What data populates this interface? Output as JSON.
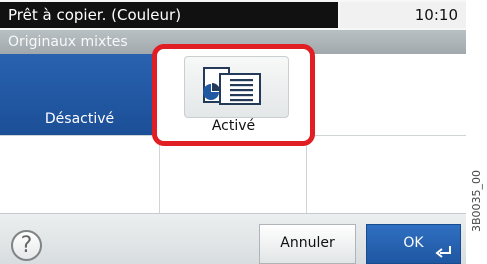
{
  "status": {
    "message": "Prêt à copier. (Couleur)",
    "time": "10:10"
  },
  "screen": {
    "title": "Originaux mixtes"
  },
  "options": {
    "off_label": "Désactivé",
    "on_label": "Activé",
    "selected": "Désactivé"
  },
  "buttons": {
    "cancel_label": "Annuler",
    "ok_label": "OK",
    "help_glyph": "?"
  },
  "reference_code": "3B0035_00",
  "icons": {
    "help": "help-icon",
    "mixed_originals": "mixed-originals-icon",
    "enter": "enter-icon"
  },
  "colors": {
    "selected_blue": "#1f57a2",
    "highlight_red": "#e11e24",
    "status_black": "#111111"
  }
}
